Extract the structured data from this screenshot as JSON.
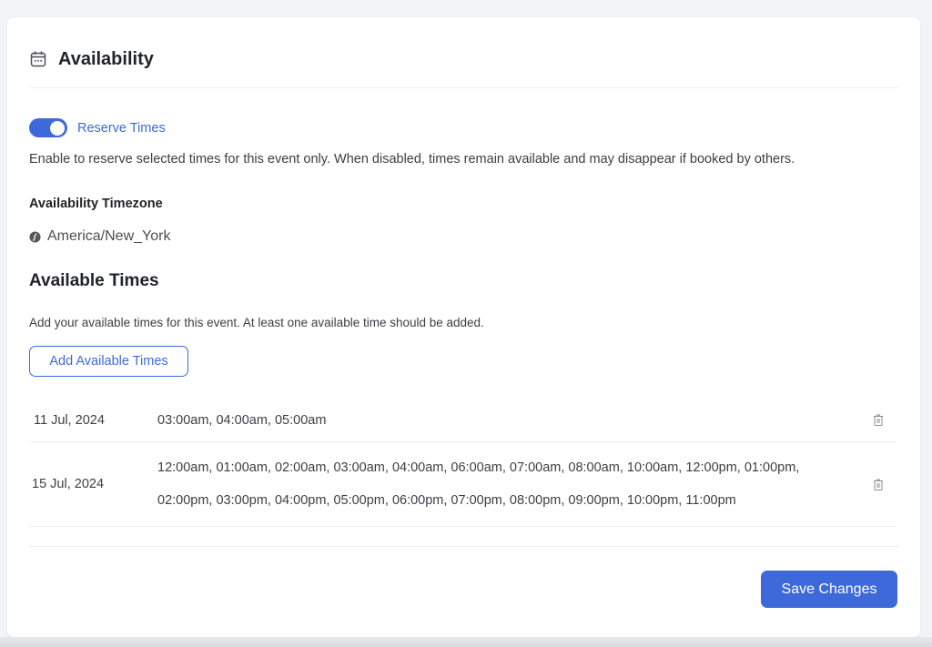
{
  "header": {
    "title": "Availability",
    "icon": "calendar-icon"
  },
  "reserve": {
    "label": "Reserve Times",
    "enabled": true,
    "description": "Enable to reserve selected times for this event only. When disabled, times remain available and may disappear if booked by others."
  },
  "timezone": {
    "label": "Availability Timezone",
    "icon": "globe-icon",
    "value": "America/New_York"
  },
  "available_times": {
    "title": "Available Times",
    "description": "Add your available times for this event. At least one available time should be added.",
    "add_button": "Add Available Times",
    "rows": [
      {
        "date": "11 Jul, 2024",
        "lines": [
          "03:00am, 04:00am, 05:00am"
        ]
      },
      {
        "date": "15 Jul, 2024",
        "lines": [
          "12:00am, 01:00am, 02:00am, 03:00am, 04:00am, 06:00am, 07:00am, 08:00am, 10:00am, 12:00pm, 01:00pm,",
          "02:00pm, 03:00pm, 04:00pm, 05:00pm, 06:00pm, 07:00pm, 08:00pm, 09:00pm, 10:00pm, 11:00pm"
        ]
      }
    ],
    "delete_icon": "trash-icon"
  },
  "footer": {
    "save_label": "Save Changes"
  },
  "colors": {
    "accent": "#3e69db",
    "background": "#f2f3f5",
    "card": "#ffffff"
  }
}
